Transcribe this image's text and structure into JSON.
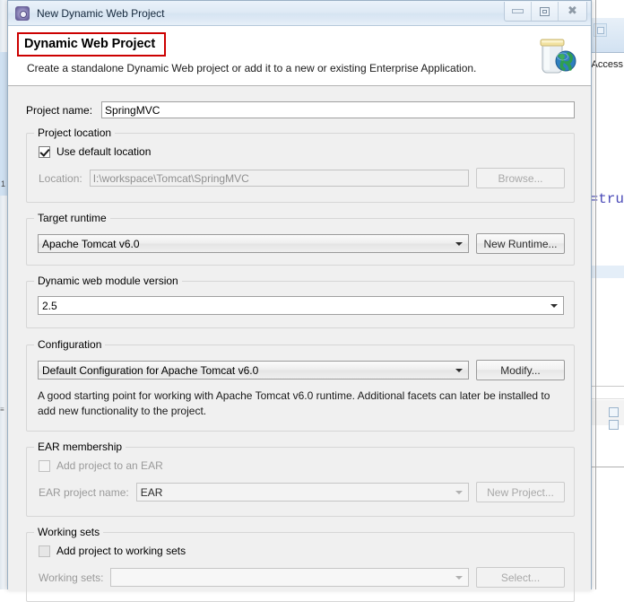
{
  "background": {
    "right_tab_label": "Access",
    "code_snippet": "=tru",
    "left_marker": "1"
  },
  "window": {
    "title": "New Dynamic Web Project",
    "icon": "eclipse-wizard-icon",
    "buttons": {
      "minimize": "minimize-icon",
      "maximize": "maximize-icon",
      "close": "close-icon"
    }
  },
  "header": {
    "title": "Dynamic Web Project",
    "description": "Create a standalone Dynamic Web project or add it to a new or existing Enterprise Application.",
    "icon": "jar-globe-icon",
    "highlight_color": "#cc0000"
  },
  "form": {
    "project_name": {
      "label": "Project name:",
      "value": "SpringMVC"
    },
    "project_location": {
      "group_label": "Project location",
      "use_default_label": "Use default location",
      "use_default_checked": true,
      "location_label": "Location:",
      "location_value": "I:\\workspace\\Tomcat\\SpringMVC",
      "browse_label": "Browse..."
    },
    "target_runtime": {
      "group_label": "Target runtime",
      "selected": "Apache Tomcat v6.0",
      "new_runtime_label": "New Runtime..."
    },
    "module_version": {
      "group_label": "Dynamic web module version",
      "selected": "2.5"
    },
    "configuration": {
      "group_label": "Configuration",
      "selected": "Default Configuration for Apache Tomcat v6.0",
      "modify_label": "Modify...",
      "description": "A good starting point for working with Apache Tomcat v6.0 runtime. Additional facets can later be installed to add new functionality to the project."
    },
    "ear_membership": {
      "group_label": "EAR membership",
      "add_to_ear_label": "Add project to an EAR",
      "add_to_ear_checked": false,
      "ear_project_label": "EAR project name:",
      "ear_project_value": "EAR",
      "new_project_label": "New Project..."
    },
    "working_sets": {
      "group_label": "Working sets",
      "add_to_working_sets_label": "Add project to working sets",
      "add_to_working_sets_checked": false,
      "working_sets_label": "Working sets:",
      "working_sets_value": "",
      "select_label": "Select..."
    }
  }
}
